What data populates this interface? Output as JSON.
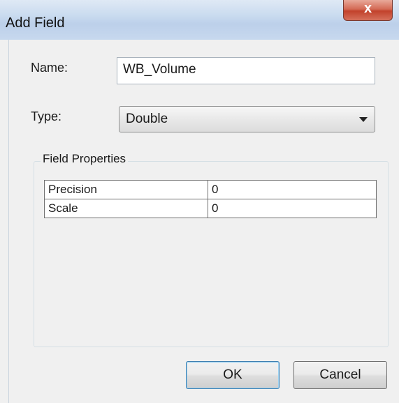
{
  "window": {
    "title": "Add Field",
    "close_glyph": "x"
  },
  "form": {
    "name_label": "Name:",
    "name_value": "WB_Volume",
    "type_label": "Type:",
    "type_value": "Double"
  },
  "field_properties": {
    "title": "Field Properties",
    "rows": [
      {
        "name": "Precision",
        "value": "0"
      },
      {
        "name": "Scale",
        "value": "0"
      }
    ]
  },
  "buttons": {
    "ok": "OK",
    "cancel": "Cancel"
  },
  "icons": {
    "close": "close-icon",
    "dropdown": "chevron-down-icon"
  }
}
